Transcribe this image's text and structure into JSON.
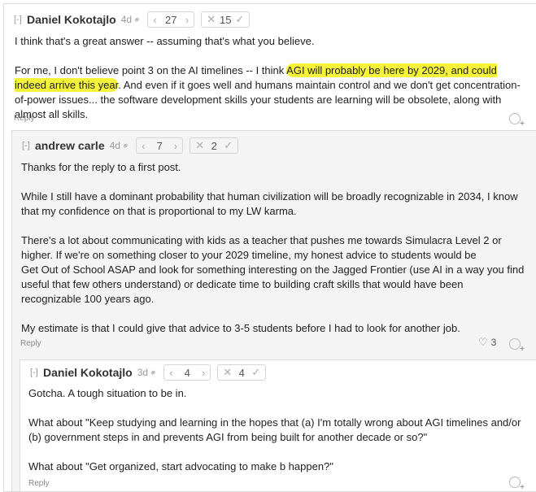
{
  "comment1": {
    "collapse": "[-]",
    "author": "Daniel Kokotajlo",
    "age": "4d",
    "karma": "27",
    "agreement": "15",
    "p1": "I think that's a great answer -- assuming that's what you believe.",
    "p2_a": "For me, I don't believe point 3 on the AI timelines -- I think ",
    "p2_highlight": "AGI will probably be here by 2029, and could indeed arrive this year",
    "p2_b": ". And even if it goes well and humans maintain control and we don't get concentration-of-power issues... the software development skills your students are learning will be obsolete, along with almost all skills.",
    "reply": "Reply"
  },
  "comment2": {
    "collapse": "[-]",
    "author": "andrew carle",
    "age": "4d",
    "karma": "7",
    "agreement": "2",
    "p1": "Thanks for the reply to a first post.",
    "p2": "While I still have a dominant probability that human civilization will be broadly recognizable in 2034, I know that my confidence on that is proportional to my LW karma.",
    "p3_a": "There's a lot about communicating with kids as a teacher that pushes me towards Simulacra Level 2 or higher. If we're on something closer to your 2029 timeline, my honest advice to students would be",
    "p3_b": "Get Out of School ASAP and look for something interesting on the Jagged Frontier (use AI in a way you find useful that few others understand) or dedicate time to building craft skills that would have been recognizable 100 years ago.",
    "p4": "My estimate is that I could give that advice to 3-5 students before I had to look for another job.",
    "reply": "Reply",
    "reactions": "3"
  },
  "comment3": {
    "collapse": "[-]",
    "author": "Daniel Kokotajlo",
    "age": "3d",
    "karma": "4",
    "agreement": "4",
    "p1": "Gotcha. A tough situation to be in.",
    "p2": "What about \"Keep studying and learning in the hopes that (a) I'm totally wrong about AGI timelines and/or (b) government steps in and prevents AGI from being built for another decade or so?\"",
    "p3": "What about \"Get organized, start advocating to make b happen?\"",
    "reply": "Reply"
  },
  "icons": {
    "link": "link-icon",
    "vote_down": "chevron-left-icon",
    "vote_up": "chevron-right-icon",
    "disagree": "x-icon",
    "agree": "check-icon",
    "reaction": "add-reaction-icon",
    "heart": "heart-icon"
  },
  "colors": {
    "highlight": "#f5f33a",
    "nested_bg": "#f4f4f4"
  }
}
